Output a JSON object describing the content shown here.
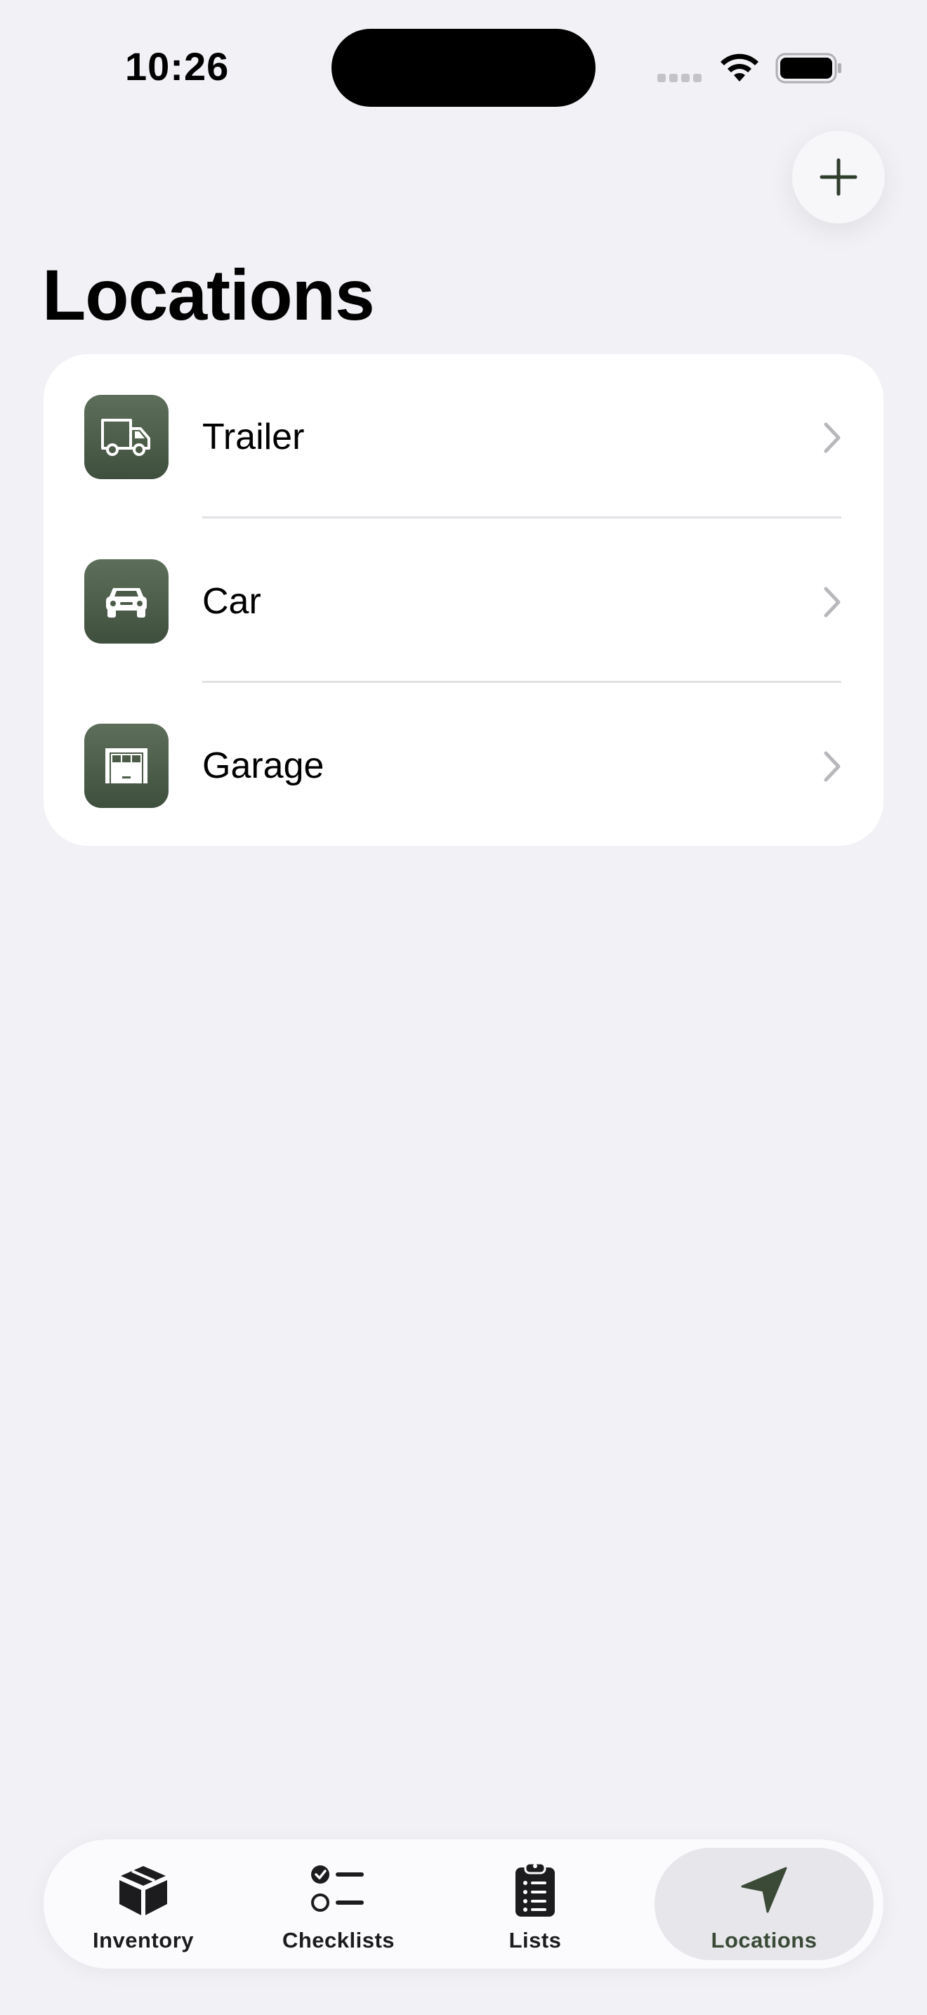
{
  "status_bar": {
    "time": "10:26"
  },
  "header": {
    "title": "Locations",
    "add_icon": "plus-icon"
  },
  "locations": [
    {
      "label": "Trailer",
      "icon": "truck-icon"
    },
    {
      "label": "Car",
      "icon": "car-icon"
    },
    {
      "label": "Garage",
      "icon": "garage-icon"
    }
  ],
  "tab_bar": {
    "tabs": [
      {
        "label": "Inventory",
        "icon": "box-icon"
      },
      {
        "label": "Checklists",
        "icon": "checklist-icon"
      },
      {
        "label": "Lists",
        "icon": "clipboard-icon"
      },
      {
        "label": "Locations",
        "icon": "location-arrow-icon"
      }
    ],
    "selected": "Locations"
  },
  "colors": {
    "accent": "#3f4f3d",
    "background": "#f2f1f6",
    "card": "#ffffff",
    "selected_tab": "#e6e6eb"
  }
}
